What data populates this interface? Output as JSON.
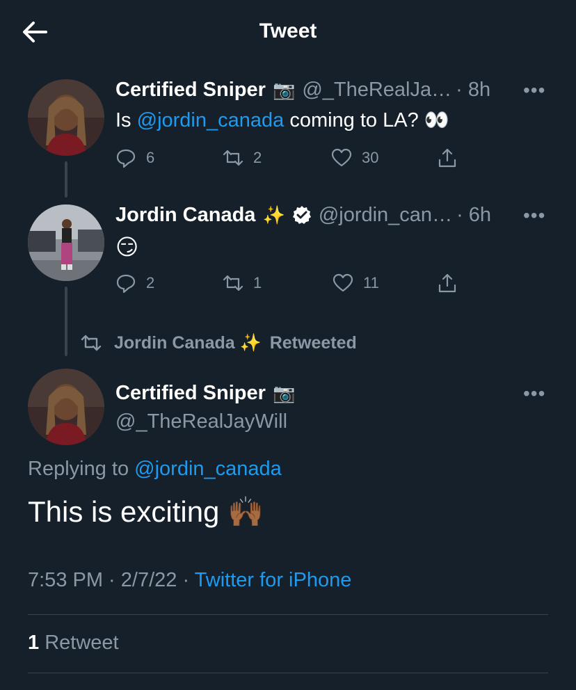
{
  "header": {
    "title": "Tweet"
  },
  "tweets": [
    {
      "name": "Certified Sniper",
      "name_emoji": "📷",
      "handle": "@_TheRealJa…",
      "time": "· 8h",
      "text_prefix": "Is ",
      "text_mention": "@jordin_canada",
      "text_suffix": " coming to LA? 👀",
      "replies": "6",
      "retweets": "2",
      "likes": "30"
    },
    {
      "name": "Jordin Canada",
      "name_emoji": "✨",
      "handle": "@jordin_can…",
      "time": "· 6h",
      "text": "😏",
      "replies": "2",
      "retweets": "1",
      "likes": "11"
    }
  ],
  "retweeted_banner": {
    "name": "Jordin Canada ✨",
    "label": "Retweeted"
  },
  "main_tweet": {
    "name": "Certified Sniper",
    "name_emoji": "📷",
    "handle": "@_TheRealJayWill",
    "replying_label": "Replying to",
    "replying_handle": "@jordin_canada",
    "text": "This is exciting 🙌🏾",
    "timestamp": "7:53 PM · 2/7/22 ·",
    "source": "Twitter for iPhone",
    "retweet_count": "1",
    "retweet_label": "Retweet"
  },
  "more_label": "•••",
  "colors": {
    "background": "#15202b",
    "accent": "#1d9bf0",
    "secondary_text": "#8b98a5",
    "divider": "#38444d"
  }
}
